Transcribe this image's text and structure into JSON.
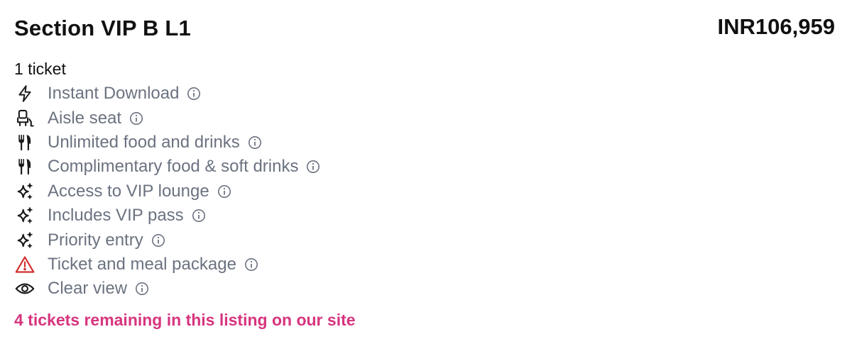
{
  "listing": {
    "section": "Section VIP B L1",
    "price": "INR106,959",
    "quantity": "1 ticket",
    "remaining": "4 tickets remaining in this listing on our site"
  },
  "colors": {
    "feature_text": "#6b7280",
    "remaining_text": "#d6357e",
    "warning_icon": "#d32f2f"
  },
  "features": [
    {
      "label": "Instant Download",
      "icon": "lightning-icon"
    },
    {
      "label": "Aisle seat",
      "icon": "aisle-seat-icon"
    },
    {
      "label": "Unlimited food and drinks",
      "icon": "fork-knife-icon"
    },
    {
      "label": "Complimentary food & soft drinks",
      "icon": "fork-knife-icon"
    },
    {
      "label": "Access to VIP lounge",
      "icon": "sparkles-icon"
    },
    {
      "label": "Includes VIP pass",
      "icon": "sparkles-icon"
    },
    {
      "label": "Priority entry",
      "icon": "sparkles-icon"
    },
    {
      "label": "Ticket and meal package",
      "icon": "warning-triangle-icon"
    },
    {
      "label": "Clear view",
      "icon": "eye-icon"
    }
  ]
}
